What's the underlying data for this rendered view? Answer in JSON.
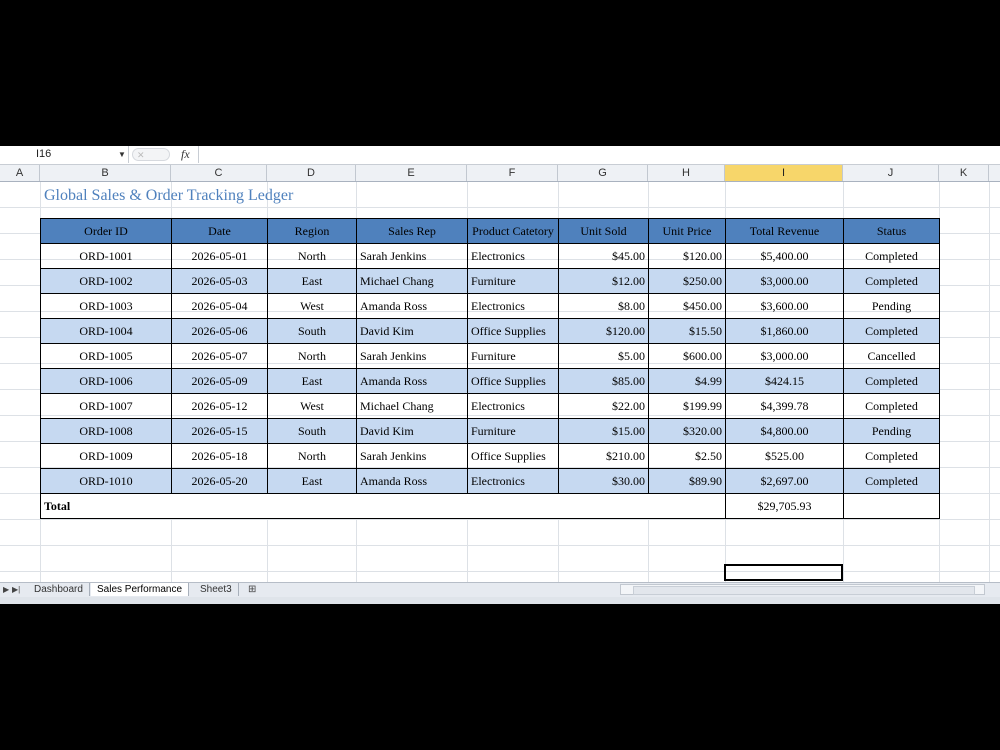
{
  "formula_bar": {
    "name_box": "I16",
    "fx_label": "fx",
    "formula": ""
  },
  "columns": [
    "A",
    "B",
    "C",
    "D",
    "E",
    "F",
    "G",
    "H",
    "I",
    "J",
    "K"
  ],
  "selected_column": "I",
  "sheet_title": "Global Sales & Order Tracking Ledger",
  "table": {
    "headers": [
      "Order ID",
      "Date",
      "Region",
      "Sales Rep",
      "Product Catetory",
      "Unit Sold",
      "Unit Price",
      "Total Revenue",
      "Status"
    ],
    "rows": [
      [
        "ORD-1001",
        "2026-05-01",
        "North",
        "Sarah Jenkins",
        "Electronics",
        "$45.00",
        "$120.00",
        "$5,400.00",
        "Completed"
      ],
      [
        "ORD-1002",
        "2026-05-03",
        "East",
        "Michael Chang",
        "Furniture",
        "$12.00",
        "$250.00",
        "$3,000.00",
        "Completed"
      ],
      [
        "ORD-1003",
        "2026-05-04",
        "West",
        "Amanda Ross",
        "Electronics",
        "$8.00",
        "$450.00",
        "$3,600.00",
        "Pending"
      ],
      [
        "ORD-1004",
        "2026-05-06",
        "South",
        "David Kim",
        "Office Supplies",
        "$120.00",
        "$15.50",
        "$1,860.00",
        "Completed"
      ],
      [
        "ORD-1005",
        "2026-05-07",
        "North",
        "Sarah Jenkins",
        "Furniture",
        "$5.00",
        "$600.00",
        "$3,000.00",
        "Cancelled"
      ],
      [
        "ORD-1006",
        "2026-05-09",
        "East",
        "Amanda Ross",
        "Office Supplies",
        "$85.00",
        "$4.99",
        "$424.15",
        "Completed"
      ],
      [
        "ORD-1007",
        "2026-05-12",
        "West",
        "Michael Chang",
        "Electronics",
        "$22.00",
        "$199.99",
        "$4,399.78",
        "Completed"
      ],
      [
        "ORD-1008",
        "2026-05-15",
        "South",
        "David Kim",
        "Furniture",
        "$15.00",
        "$320.00",
        "$4,800.00",
        "Pending"
      ],
      [
        "ORD-1009",
        "2026-05-18",
        "North",
        "Sarah Jenkins",
        "Office Supplies",
        "$210.00",
        "$2.50",
        "$525.00",
        "Completed"
      ],
      [
        "ORD-1010",
        "2026-05-20",
        "East",
        "Amanda Ross",
        "Electronics",
        "$30.00",
        "$89.90",
        "$2,697.00",
        "Completed"
      ]
    ],
    "total_label": "Total",
    "total_value": "$29,705.93"
  },
  "sheet_tabs": [
    "Dashboard",
    "Sales Performance",
    "Sheet3"
  ],
  "active_tab": "Sales Performance",
  "colors": {
    "header_fill": "#4f81bd",
    "alt_row_fill": "#c6d9f1",
    "title_color": "#4f81bd",
    "selected_header": "#f7d66a"
  },
  "icons": {
    "first_sheet": "first-sheet-icon",
    "last_sheet": "last-sheet-icon",
    "insert_sheet": "insert-sheet-icon"
  }
}
